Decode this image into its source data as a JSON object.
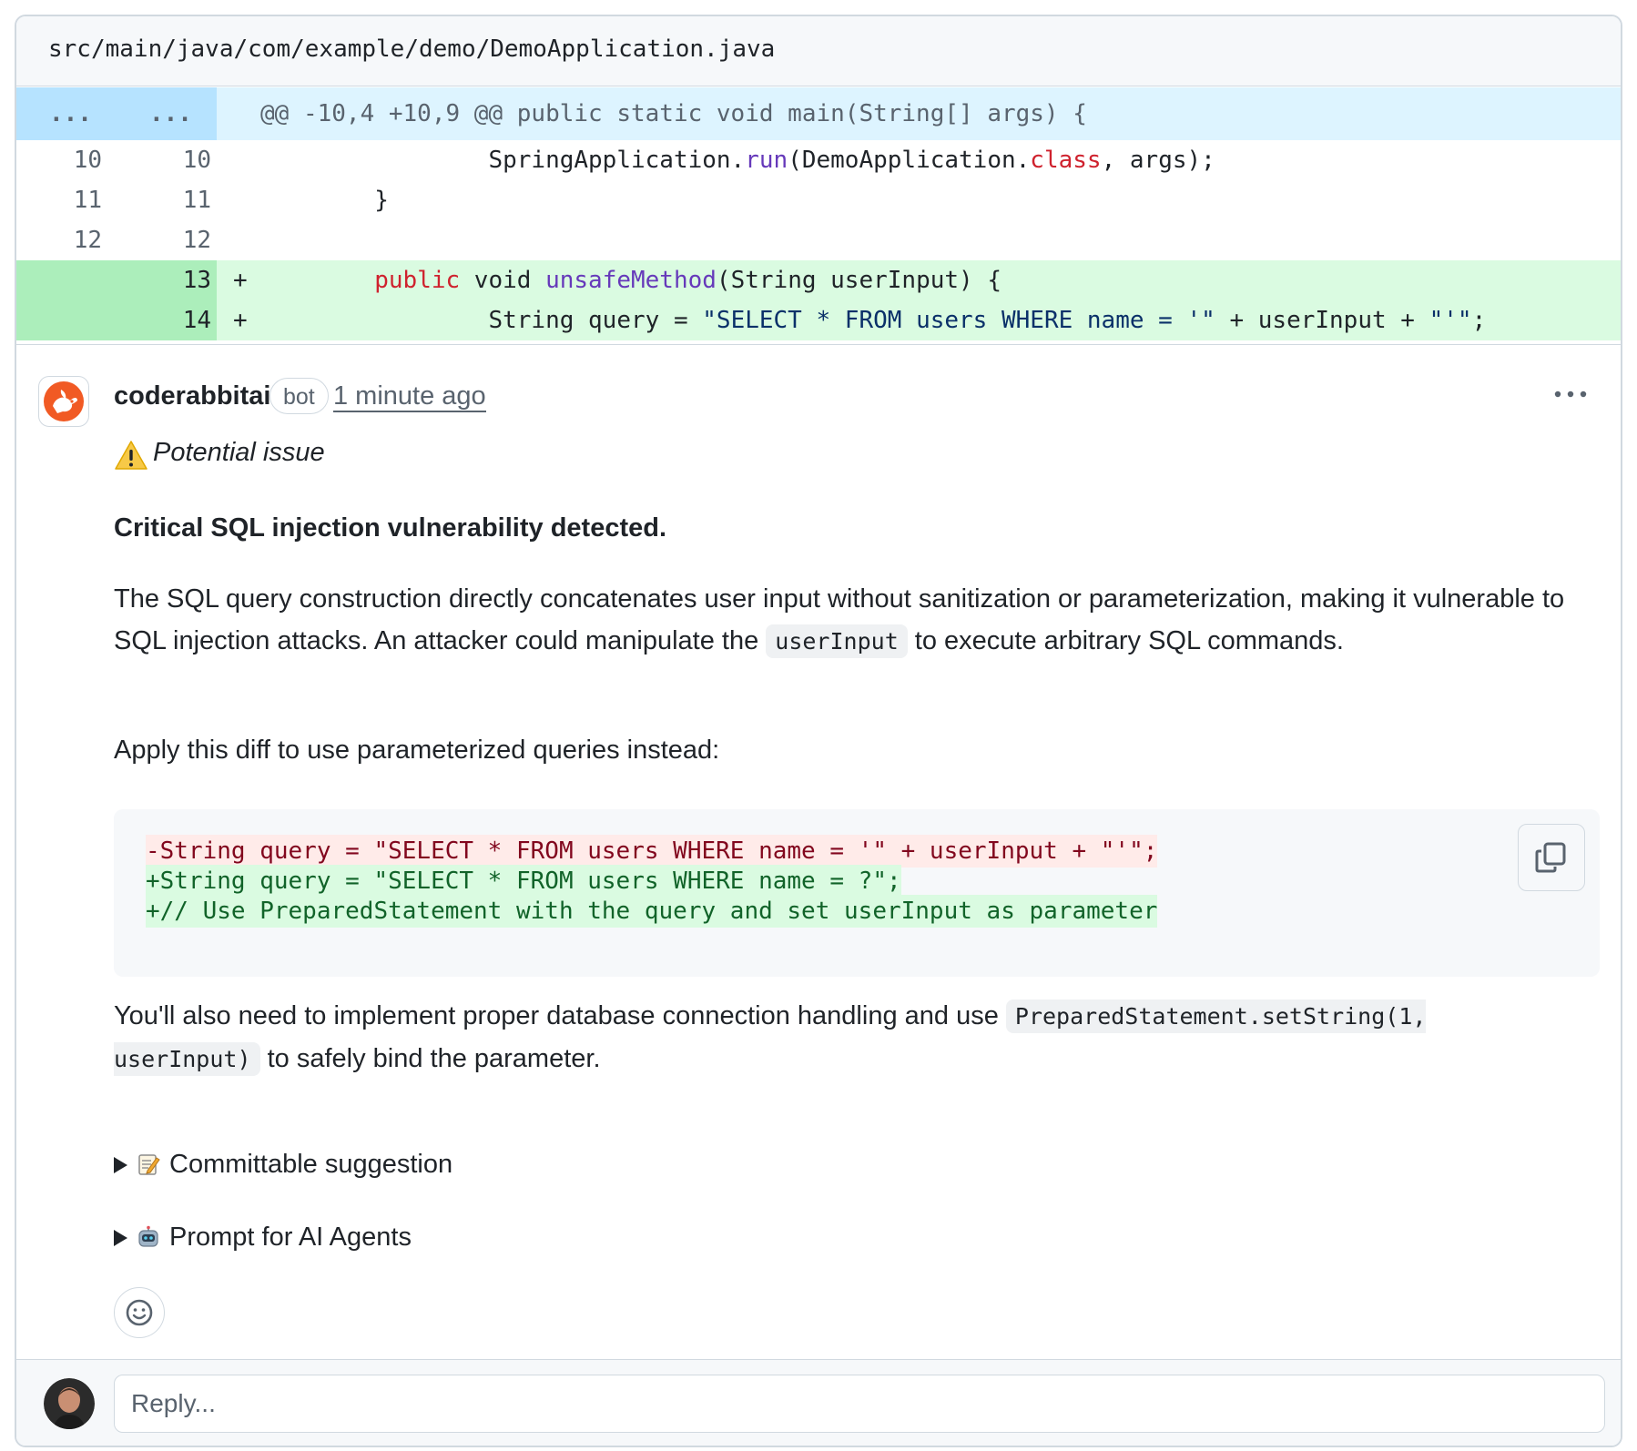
{
  "file": {
    "path": "src/main/java/com/example/demo/DemoApplication.java"
  },
  "diff": {
    "hunk": {
      "old_dots": "...",
      "new_dots": "...",
      "header": "@@ -10,4 +10,9 @@ public static void main(String[] args) {"
    },
    "lines": [
      {
        "old": "10",
        "new": "10",
        "marker": "",
        "type": "context",
        "tokens": [
          {
            "t": "                SpringApplication.",
            "c": ""
          },
          {
            "t": "run",
            "c": "fn"
          },
          {
            "t": "(DemoApplication.",
            "c": ""
          },
          {
            "t": "class",
            "c": "kw"
          },
          {
            "t": ", args);",
            "c": ""
          }
        ]
      },
      {
        "old": "11",
        "new": "11",
        "marker": "",
        "type": "context",
        "tokens": [
          {
            "t": "        }",
            "c": ""
          }
        ]
      },
      {
        "old": "12",
        "new": "12",
        "marker": "",
        "type": "context",
        "tokens": [
          {
            "t": "",
            "c": ""
          }
        ]
      },
      {
        "old": "",
        "new": "13",
        "marker": "+",
        "type": "add",
        "tokens": [
          {
            "t": "        ",
            "c": ""
          },
          {
            "t": "public",
            "c": "kw"
          },
          {
            "t": " void ",
            "c": ""
          },
          {
            "t": "unsafeMethod",
            "c": "fn"
          },
          {
            "t": "(String userInput) {",
            "c": ""
          }
        ]
      },
      {
        "old": "",
        "new": "14",
        "marker": "+",
        "type": "add",
        "tokens": [
          {
            "t": "                String query = ",
            "c": ""
          },
          {
            "t": "\"SELECT * FROM users WHERE name = '\"",
            "c": "str"
          },
          {
            "t": " + userInput + ",
            "c": ""
          },
          {
            "t": "\"'\"",
            "c": "str"
          },
          {
            "t": ";",
            "c": ""
          }
        ]
      }
    ]
  },
  "comment": {
    "author": "coderabbitai",
    "badge": "bot",
    "timestamp": "1 minute ago",
    "more_icon": "kebab-horizontal-icon",
    "warning_label": "Potential issue",
    "headline": "Critical SQL injection vulnerability detected.",
    "p1_before": "The SQL query construction directly concatenates user input without sanitization or parameterization, making it vulnerable to SQL injection attacks. An attacker could manipulate the ",
    "p1_code": "userInput",
    "p1_after": " to execute arbitrary SQL commands.",
    "p2": "Apply this diff to use parameterized queries instead:",
    "suggestion": [
      {
        "type": "del",
        "text": "-String query = \"SELECT * FROM users WHERE name = '\" + userInput + \"'\";"
      },
      {
        "type": "add",
        "text": "+String query = \"SELECT * FROM users WHERE name = ?\";"
      },
      {
        "type": "add",
        "text": "+// Use PreparedStatement with the query and set userInput as parameter"
      }
    ],
    "p3_before": "You'll also need to implement proper database connection handling and use ",
    "p3_code": "PreparedStatement.setString(1, userInput)",
    "p3_after": " to safely bind the parameter.",
    "details": [
      {
        "label": "Committable suggestion",
        "icon": "memo-icon"
      },
      {
        "label": "Prompt for AI Agents",
        "icon": "robot-icon"
      }
    ]
  },
  "reply": {
    "placeholder": "Reply..."
  },
  "colors": {
    "add_bg": "#dafbe1",
    "add_gutter": "#aceebb",
    "hunk_bg": "#ddf4ff",
    "hunk_gutter": "#b6e3ff",
    "bot_orange": "#f15a24"
  }
}
